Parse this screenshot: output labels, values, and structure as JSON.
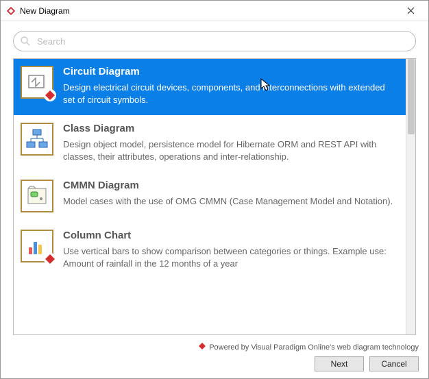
{
  "window": {
    "title": "New Diagram"
  },
  "search": {
    "placeholder": "Search"
  },
  "items": [
    {
      "title": "Circuit Diagram",
      "desc": "Design electrical circuit devices, components, and interconnections with extended set of circuit symbols.",
      "selected": true
    },
    {
      "title": "Class Diagram",
      "desc": "Design object model, persistence model for Hibernate ORM and REST API with classes, their attributes, operations and inter-relationship.",
      "selected": false
    },
    {
      "title": "CMMN Diagram",
      "desc": "Model cases with the use of OMG CMMN (Case Management Model and Notation).",
      "selected": false
    },
    {
      "title": "Column Chart",
      "desc": "Use vertical bars to show comparison between categories or things. Example use: Amount of rainfall in the 12 months of a year",
      "selected": false
    }
  ],
  "footer": {
    "powered": "Powered by Visual Paradigm Online's web diagram technology",
    "next": "Next",
    "cancel": "Cancel"
  }
}
